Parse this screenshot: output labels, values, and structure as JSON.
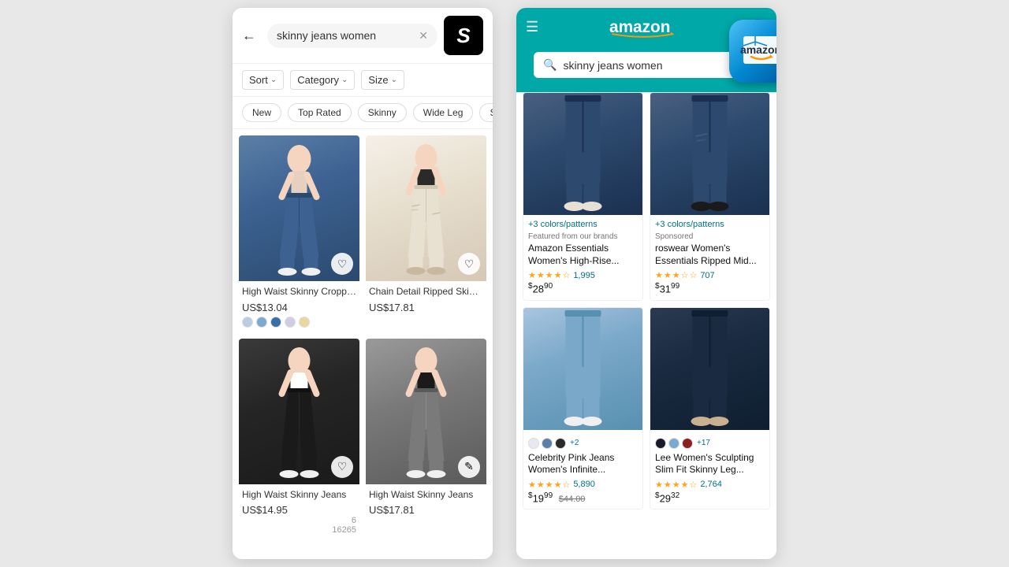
{
  "shein": {
    "app_name": "SHEIN",
    "app_logo": "S",
    "search_query": "skinny jeans women",
    "filters": [
      {
        "label": "Sort",
        "id": "sort"
      },
      {
        "label": "Category",
        "id": "category"
      },
      {
        "label": "Size",
        "id": "size"
      }
    ],
    "tags": [
      "New",
      "Top Rated",
      "Skinny",
      "Wide Leg",
      "Straig..."
    ],
    "products": [
      {
        "name": "High Waist Skinny Cropped J...",
        "price": "US$13.04",
        "colors": [
          "#b8cee0",
          "#7baad0",
          "#3a6ea8",
          "#d0cde0",
          "#e8d8a0"
        ],
        "has_heart": true,
        "jeans_style": "jeans-blue-1"
      },
      {
        "name": "Chain Detail Ripped Skinny J...",
        "price": "US$17.81",
        "colors": [],
        "has_heart": true,
        "jeans_style": "jeans-white-1"
      },
      {
        "name": "High Waist Skinny Jeans",
        "price": "US$14.95",
        "colors": [],
        "has_heart": true,
        "has_edit": false,
        "review_count": "6\n16265",
        "jeans_style": "jeans-black-1"
      },
      {
        "name": "High Waist Skinny Jeans",
        "price": "US$17.81",
        "colors": [],
        "has_heart": false,
        "has_edit": true,
        "jeans_style": "jeans-gray-1"
      }
    ]
  },
  "amazon": {
    "app_name": "amazon",
    "search_query": "skinny jeans women",
    "header_bg": "#00A8A8",
    "products": [
      {
        "name": "Amazon Essentials Women's High-Rise...",
        "label_type": "featured",
        "label": "Featured from our brands",
        "stars": 4.5,
        "star_count": 5,
        "reviews": "1,995",
        "price_whole": "28",
        "price_cents": "90",
        "colors_text": "+3 colors/patterns",
        "jeans_style": "amz-jeans-blue-dark",
        "swatches": []
      },
      {
        "name": "roswear Women's Essentials Ripped Mid...",
        "label_type": "sponsored",
        "label": "Sponsored",
        "stars": 3.5,
        "star_count": 5,
        "reviews": "707",
        "price_whole": "31",
        "price_cents": "99",
        "colors_text": "+3 colors/patterns",
        "jeans_style": "amz-jeans-blue-dark",
        "swatches": []
      },
      {
        "name": "Celebrity Pink Jeans Women's Infinite...",
        "label_type": "",
        "label": "",
        "stars": 4.5,
        "star_count": 5,
        "reviews": "5,890",
        "price_whole": "19",
        "price_cents": "99",
        "price_original": "$44.00",
        "jeans_style": "amz-jeans-light-blue",
        "swatches": [
          {
            "color": "#e8e8f0"
          },
          {
            "color": "#5b7fa6"
          },
          {
            "color": "#2a2a2a"
          }
        ],
        "swatch_more": "+2"
      },
      {
        "name": "Lee Women's Sculpting Slim Fit Skinny Leg...",
        "label_type": "",
        "label": "",
        "stars": 4.5,
        "star_count": 5,
        "reviews": "2,764",
        "price_whole": "29",
        "price_cents": "32",
        "jeans_style": "amz-jeans-dark-2",
        "swatches": [
          {
            "color": "#1a1a2e"
          },
          {
            "color": "#7baad0"
          },
          {
            "color": "#8b2020"
          }
        ],
        "swatch_more": "+17"
      }
    ]
  }
}
